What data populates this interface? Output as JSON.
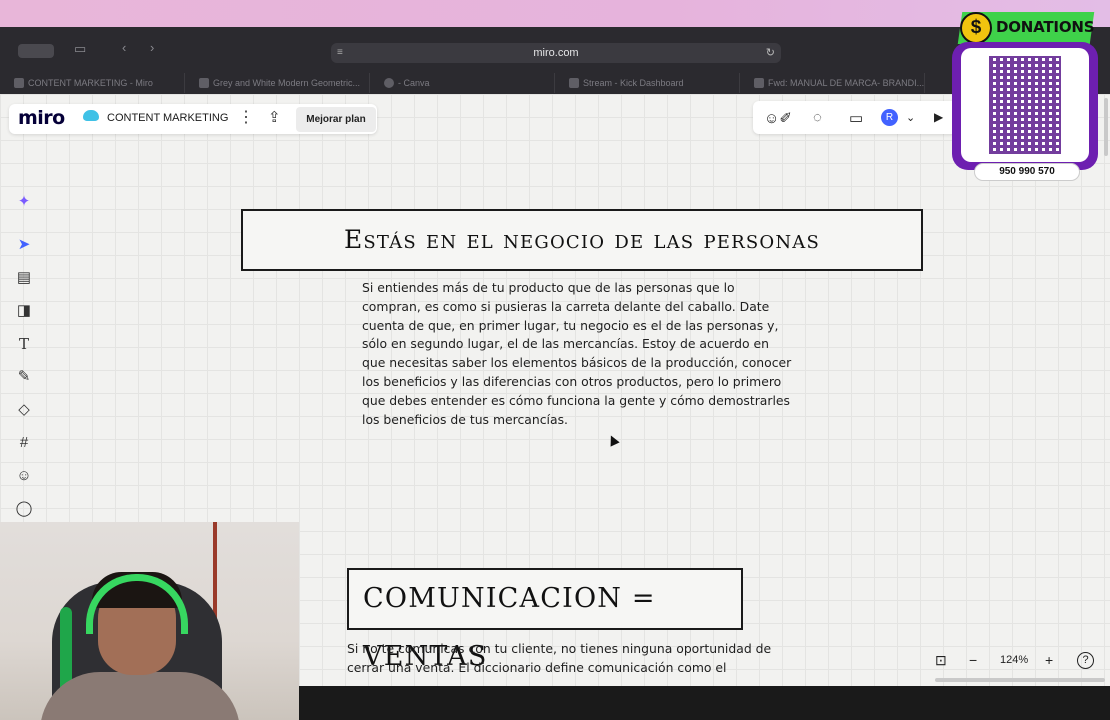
{
  "browser": {
    "url": "miro.com",
    "tabs": [
      {
        "title": "CONTENT MARKETING - Miro"
      },
      {
        "title": "Grey and White Modern Geometric..."
      },
      {
        "title": "- Canva"
      },
      {
        "title": "Stream - Kick Dashboard"
      },
      {
        "title": "Fwd: MANUAL DE MARCA- BRANDI..."
      }
    ]
  },
  "miro": {
    "logo": "miro",
    "board_name": "CONTENT MARKETING",
    "upgrade_label": "Mejorar plan",
    "avatar_initial": "R",
    "zoom_level": "124%"
  },
  "canvas": {
    "title_1": "Estás en el negocio de las personas",
    "paragraph_1": "Si entiendes más de tu producto que de las personas que lo compran, es como si pusieras la carreta delante del caballo. Date cuenta de que, en primer lugar, tu negocio es el de las personas y, sólo en segundo lugar, el de las mercancías. Estoy de acuerdo en que necesitas saber los elementos básicos de la producción, conocer los beneficios y las diferencias con otros productos, pero lo primero que debes entender es cómo funciona la gente y cómo demostrarles los beneficios de tus mercancías.",
    "title_2": "COMUNICACION = VENTAS",
    "paragraph_2": "Si no te comunicas con tu cliente, no tienes ninguna oportunidad de cerrar una venta. El diccionario define comunicación como el"
  },
  "overlay": {
    "donations_label": "DONATIONS",
    "phone": "950 990 570"
  },
  "colors": {
    "miro_blue": "#4262ff",
    "donations_green": "#3fd24a",
    "qr_purple": "#6d1fb0"
  }
}
